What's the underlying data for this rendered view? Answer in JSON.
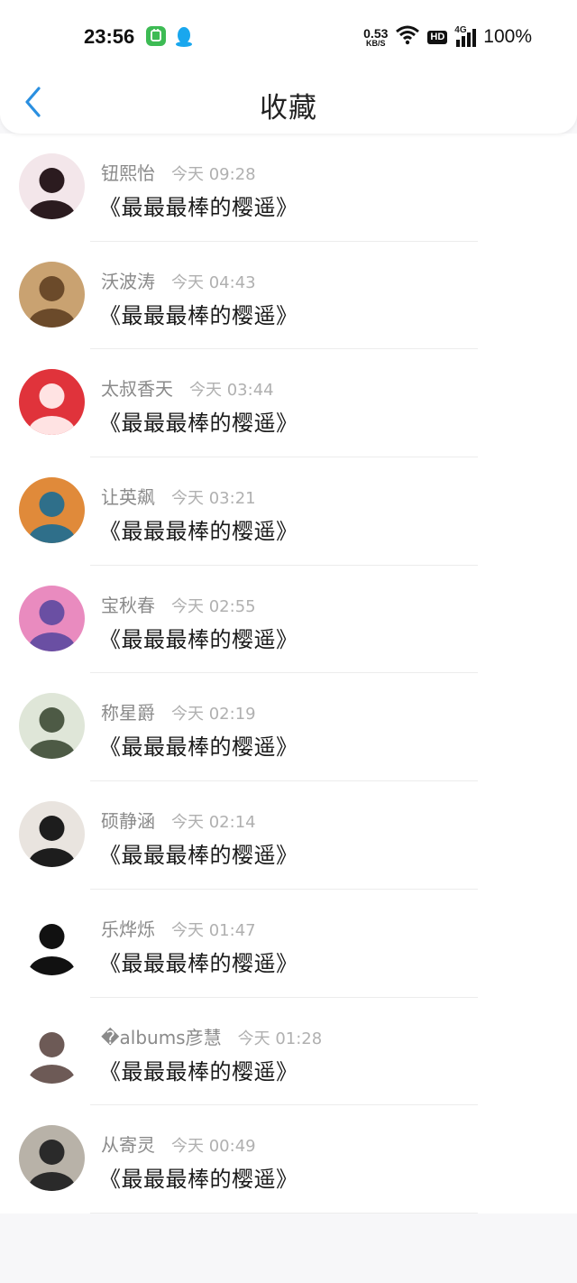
{
  "status_bar": {
    "time": "23:56",
    "speed_value": "0.53",
    "speed_unit": "KB/S",
    "hd_label": "HD",
    "network_label": "4G",
    "battery": "100%",
    "app_icon_colors": [
      "#3dbb54",
      "#19a7ee"
    ]
  },
  "header": {
    "title": "收藏",
    "back_icon": "chevron-left-icon",
    "accent": "#2a8fe0"
  },
  "favorites": [
    {
      "name": "钮熙怡",
      "time": "今天 09:28",
      "title": "《最最最棒的樱遥》",
      "avatar_bg": "#f3e6ea",
      "avatar_fg": "#2b1b1f"
    },
    {
      "name": "沃波涛",
      "time": "今天 04:43",
      "title": "《最最最棒的樱遥》",
      "avatar_bg": "#c9a271",
      "avatar_fg": "#6b4a2a"
    },
    {
      "name": "太叔香天",
      "time": "今天 03:44",
      "title": "《最最最棒的樱遥》",
      "avatar_bg": "#e0333b",
      "avatar_fg": "#ffe3e3"
    },
    {
      "name": "让英飙",
      "time": "今天 03:21",
      "title": "《最最最棒的樱遥》",
      "avatar_bg": "#e08a3a",
      "avatar_fg": "#2f6f8a"
    },
    {
      "name": "宝秋春",
      "time": "今天 02:55",
      "title": "《最最最棒的樱遥》",
      "avatar_bg": "#e98bbf",
      "avatar_fg": "#6a4fa3"
    },
    {
      "name": "称星爵",
      "time": "今天 02:19",
      "title": "《最最最棒的樱遥》",
      "avatar_bg": "#dfe6d8",
      "avatar_fg": "#4d5a45"
    },
    {
      "name": "硕静涵",
      "time": "今天 02:14",
      "title": "《最最最棒的樱遥》",
      "avatar_bg": "#e9e4df",
      "avatar_fg": "#1d1d1d"
    },
    {
      "name": "乐烨烁",
      "time": "今天 01:47",
      "title": "《最最最棒的樱遥》",
      "avatar_bg": "#ffffff",
      "avatar_fg": "#111111"
    },
    {
      "name": "�albums彦慧",
      "time": "今天 01:28",
      "title": "《最最最棒的樱遥》",
      "avatar_bg": "#ffffff",
      "avatar_fg": "#6d5a56"
    },
    {
      "name": "从寄灵",
      "time": "今天 00:49",
      "title": "《最最最棒的樱遥》",
      "avatar_bg": "#b8b2a8",
      "avatar_fg": "#2a2a2a"
    }
  ]
}
